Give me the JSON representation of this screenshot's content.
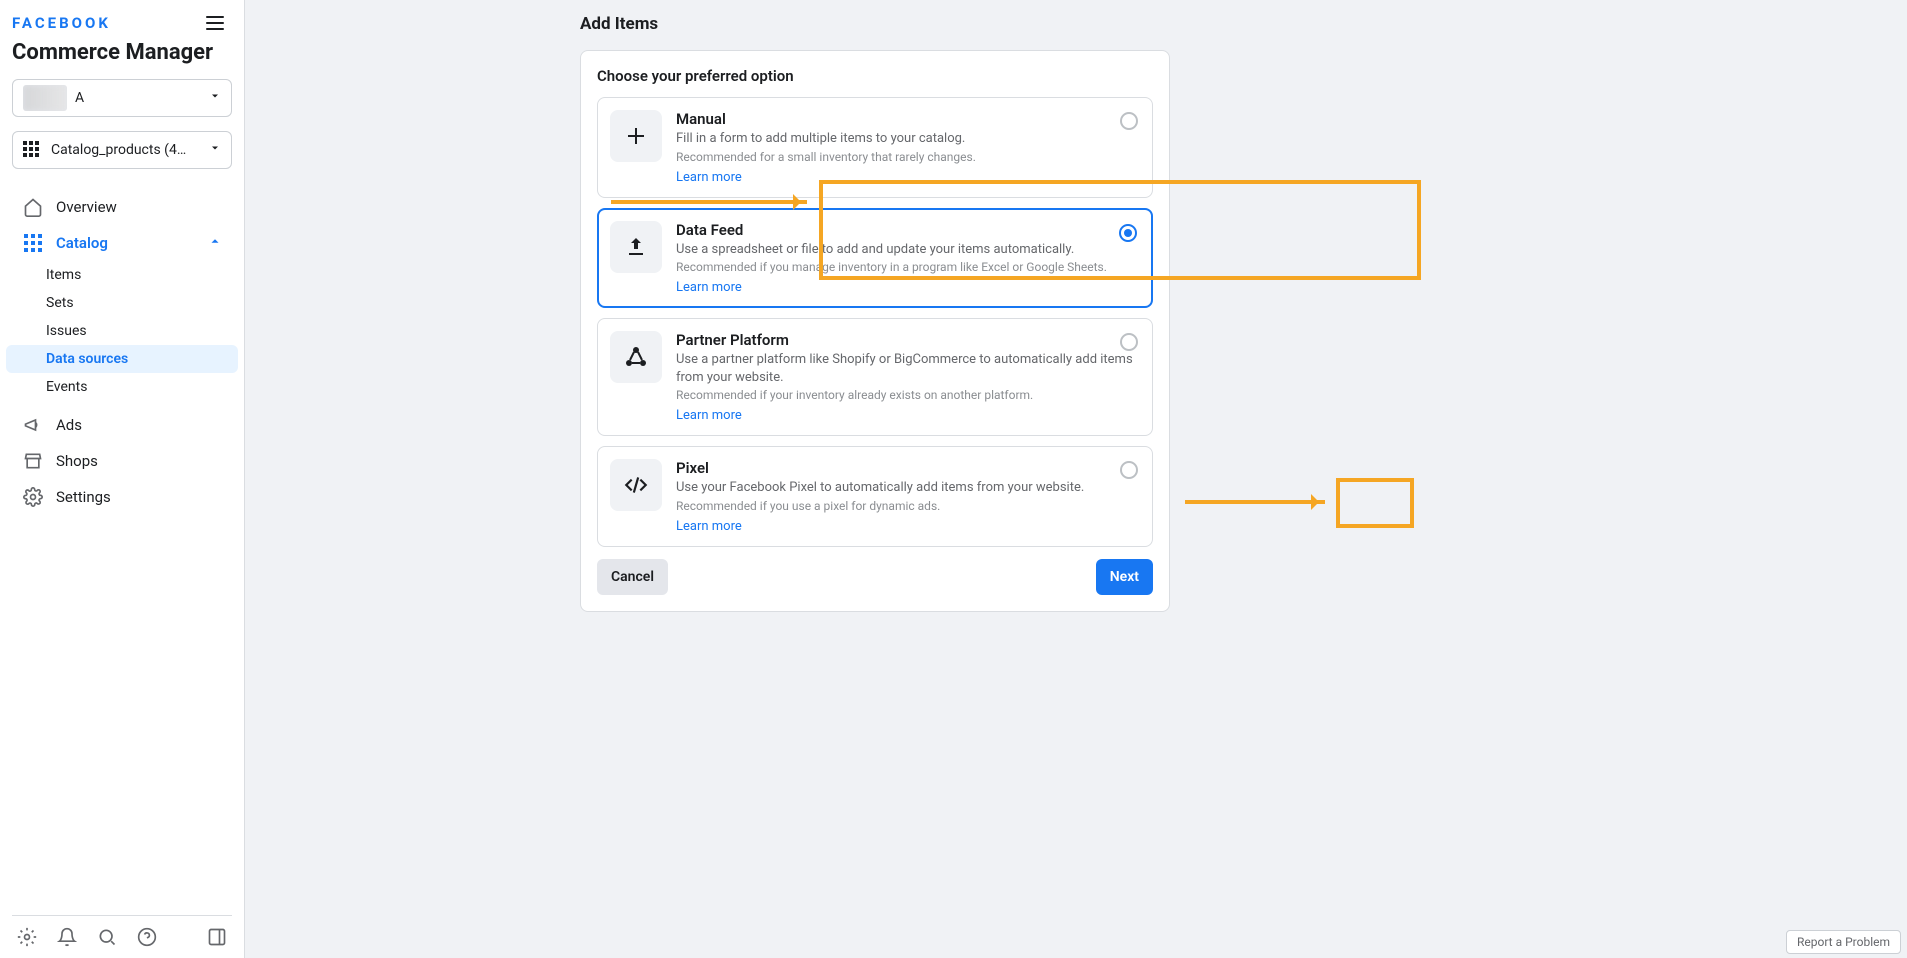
{
  "brand": "FACEBOOK",
  "page_title": "Commerce Manager",
  "account_selector": {
    "label": "A"
  },
  "catalog_selector": {
    "label": "Catalog_products (43461994..."
  },
  "nav": {
    "overview": "Overview",
    "catalog": "Catalog",
    "catalog_sub": {
      "items": "Items",
      "sets": "Sets",
      "issues": "Issues",
      "data_sources": "Data sources",
      "events": "Events"
    },
    "ads": "Ads",
    "shops": "Shops",
    "settings": "Settings"
  },
  "main": {
    "title": "Add Items",
    "heading": "Choose your preferred option",
    "options": [
      {
        "title": "Manual",
        "desc": "Fill in a form to add multiple items to your catalog.",
        "rec": "Recommended for a small inventory that rarely changes.",
        "link": "Learn more"
      },
      {
        "title": "Data Feed",
        "desc": "Use a spreadsheet or file to add and update your items automatically.",
        "rec": "Recommended if you manage inventory in a program like Excel or Google Sheets.",
        "link": "Learn more"
      },
      {
        "title": "Partner Platform",
        "desc": "Use a partner platform like Shopify or BigCommerce to automatically add items from your website.",
        "rec": "Recommended if your inventory already exists on another platform.",
        "link": "Learn more"
      },
      {
        "title": "Pixel",
        "desc": "Use your Facebook Pixel to automatically add items from your website.",
        "rec": "Recommended if you use a pixel for dynamic ads.",
        "link": "Learn more"
      }
    ],
    "buttons": {
      "cancel": "Cancel",
      "next": "Next"
    }
  },
  "footer": {
    "report": "Report a Problem"
  }
}
